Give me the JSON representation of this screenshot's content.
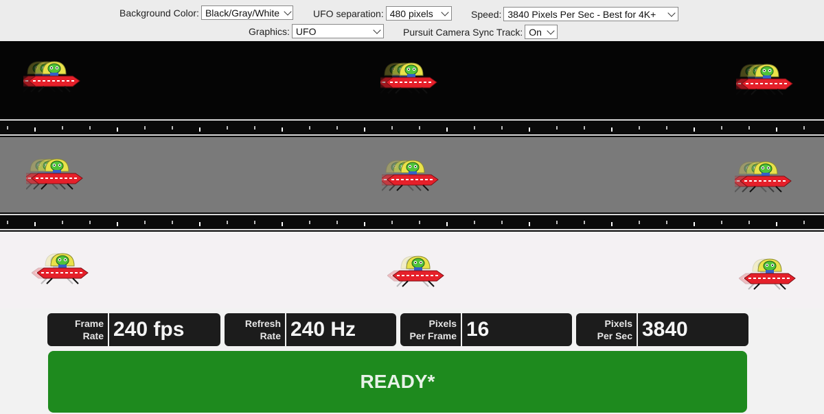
{
  "controls": {
    "background_color": {
      "label": "Background Color:",
      "value": "Black/Gray/White"
    },
    "ufo_separation": {
      "label": "UFO separation:",
      "value": "480 pixels"
    },
    "speed": {
      "label": "Speed:",
      "value": "3840 Pixels Per Sec - Best for 4K+"
    },
    "graphics": {
      "label": "Graphics:",
      "value": "UFO"
    },
    "pursuit_sync": {
      "label": "Pursuit Camera Sync Track:",
      "value": "On"
    }
  },
  "stats": {
    "frame_rate": {
      "label": "Frame\nRate",
      "value": "240 fps"
    },
    "refresh_rate": {
      "label": "Refresh\nRate",
      "value": "240 Hz"
    },
    "pixels_per_frame": {
      "label": "Pixels\nPer Frame",
      "value": "16"
    },
    "pixels_per_sec": {
      "label": "Pixels\nPer Sec",
      "value": "3840"
    }
  },
  "status": {
    "text": "READY*"
  },
  "colors": {
    "lane_black": "#050505",
    "lane_gray": "#7a7a7a",
    "lane_white": "#f4f1f3",
    "ready_green": "#1e8a1e",
    "saucer_red": "#e5202a",
    "alien_green": "#4fc23a",
    "dome_yellow": "#e9e24a"
  }
}
